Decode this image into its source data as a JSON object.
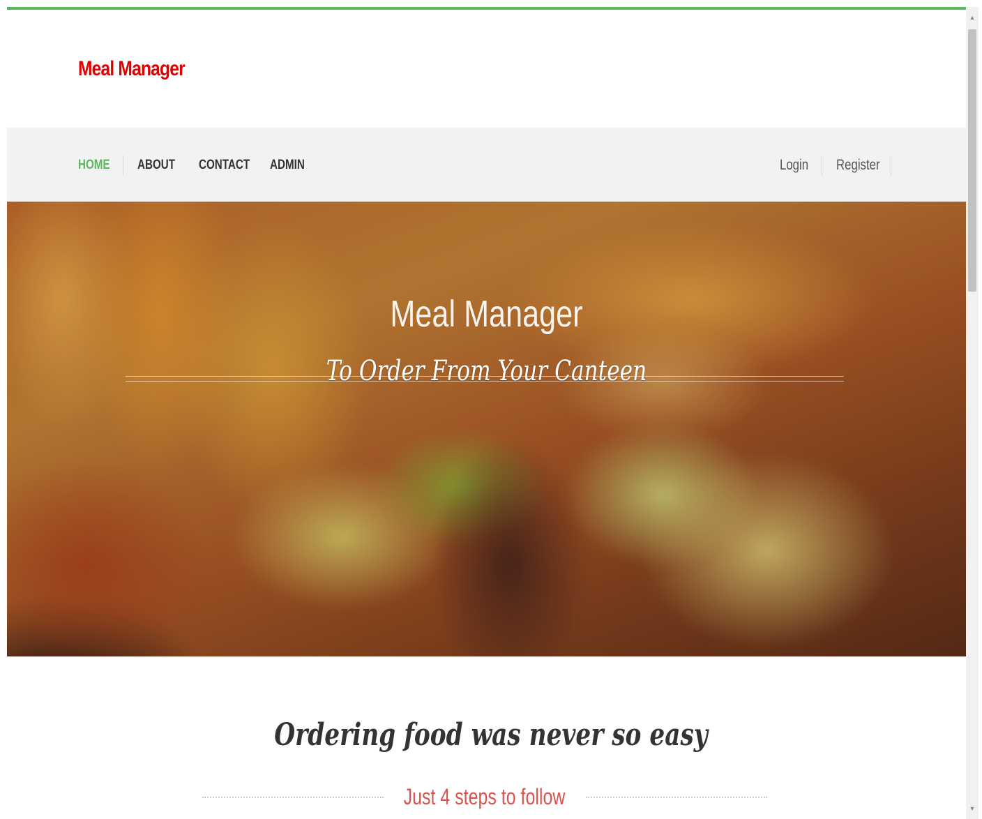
{
  "header": {
    "brand": "Meal Manager",
    "accent_color": "#5cb85c",
    "brand_color": "#e00000"
  },
  "nav": {
    "items": [
      {
        "label": "HOME",
        "active": true
      },
      {
        "label": "ABOUT",
        "active": false
      },
      {
        "label": "CONTACT",
        "active": false
      },
      {
        "label": "ADMIN",
        "active": false
      }
    ],
    "auth": {
      "login": "Login",
      "register": "Register"
    }
  },
  "hero": {
    "title": "Meal Manager",
    "subtitle": "To Order From Your Canteen"
  },
  "intro": {
    "title": "Ordering food was never so easy",
    "steps": "Just 4 steps to follow",
    "steps_color": "#d9534f"
  },
  "scrollbar": {
    "up_icon": "▲",
    "down_icon": "▼"
  }
}
